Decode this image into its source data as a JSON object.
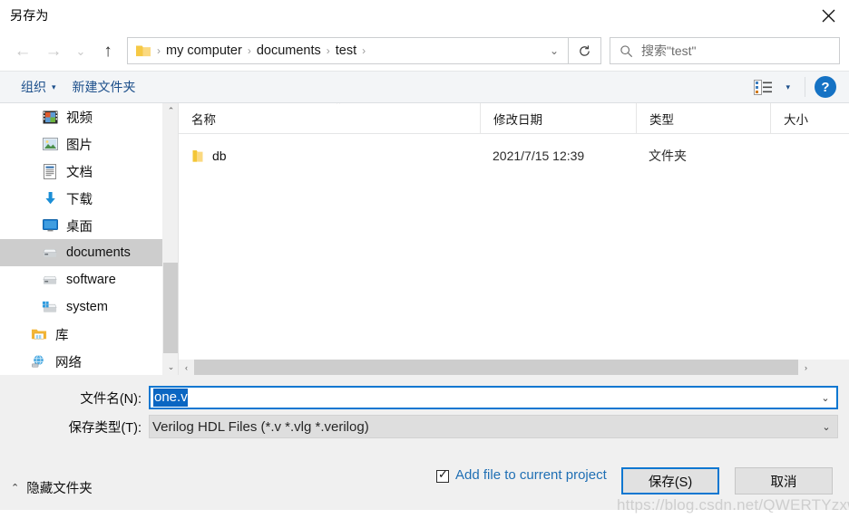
{
  "window": {
    "title": "另存为",
    "close_label": "✕"
  },
  "nav": {
    "back": "←",
    "forward": "→",
    "recent": "⌄",
    "up": "↑",
    "refresh": "↻",
    "breadcrumb": [
      {
        "label": "my computer"
      },
      {
        "label": "documents"
      },
      {
        "label": "test"
      }
    ],
    "separator": "›",
    "dropdown": "⌄"
  },
  "search": {
    "placeholder": "搜索\"test\"",
    "icon": "search-icon"
  },
  "commandbar": {
    "organize_label": "组织",
    "organize_caret": "▾",
    "new_folder_label": "新建文件夹",
    "view_caret": "▾",
    "help_label": "?"
  },
  "sidebar": {
    "items": [
      {
        "label": "视频",
        "icon": "videos-icon",
        "selected": false
      },
      {
        "label": "图片",
        "icon": "pictures-icon",
        "selected": false
      },
      {
        "label": "文档",
        "icon": "documents-icon",
        "selected": false
      },
      {
        "label": "下载",
        "icon": "downloads-icon",
        "selected": false
      },
      {
        "label": "桌面",
        "icon": "desktop-icon",
        "selected": false
      },
      {
        "label": "documents",
        "icon": "drive-icon",
        "selected": true
      },
      {
        "label": "software",
        "icon": "drive-icon",
        "selected": false
      },
      {
        "label": "system",
        "icon": "system-drive-icon",
        "selected": false
      },
      {
        "label": "库",
        "icon": "library-icon",
        "selected": false
      },
      {
        "label": "网络",
        "icon": "network-icon",
        "selected": false
      }
    ],
    "scroll_up": "⌃",
    "scroll_down": "⌄"
  },
  "filelist": {
    "columns": [
      {
        "label": "名称"
      },
      {
        "label": "修改日期"
      },
      {
        "label": "类型"
      },
      {
        "label": "大小"
      }
    ],
    "sort_indicator": "⌃",
    "rows": [
      {
        "name": "db",
        "date": "2021/7/15 12:39",
        "type": "文件夹",
        "size": "",
        "icon": "folder-icon"
      }
    ],
    "scroll_left": "‹",
    "scroll_right": "›"
  },
  "form": {
    "filename_label": "文件名(N):",
    "filename_value": "one.v",
    "filetype_label": "保存类型(T):",
    "filetype_value": "Verilog HDL Files (*.v *.vlg *.verilog)",
    "chevron": "⌄"
  },
  "footer": {
    "hide_folders_label": "隐藏文件夹",
    "hide_folders_caret": "⌃",
    "add_file_label": "Add file to current project",
    "add_file_checked": true,
    "checkbox_tick": "✓",
    "save_label": "保存(S)",
    "cancel_label": "取消"
  },
  "watermark": {
    "text": "https://blog.csdn.net/QWERTYzxw"
  },
  "colors": {
    "accent": "#0d77d1",
    "link": "#1c4f8b",
    "selection": "#0a66c2",
    "panel": "#f0f0f0",
    "command_bar": "#f3f5f7",
    "sidebar_selected": "#cdcdcd"
  }
}
